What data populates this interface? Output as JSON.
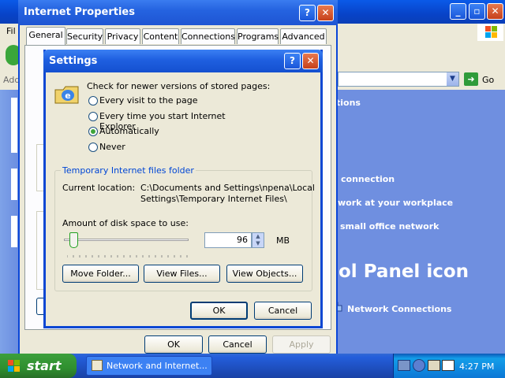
{
  "background_window": {
    "menu_partial": "Fil",
    "address_label_partial": "Add",
    "go_label": "Go",
    "tasks": [
      {
        "label": "tions"
      },
      {
        "label": "connection"
      },
      {
        "label": "work at your workplace"
      },
      {
        "label": "small office network"
      }
    ],
    "big_title": "ol Panel icon",
    "network_connections": "Network Connections"
  },
  "internet_properties": {
    "title": "Internet Properties",
    "tabs": [
      "General",
      "Security",
      "Privacy",
      "Content",
      "Connections",
      "Programs",
      "Advanced"
    ],
    "active_tab": "General",
    "buttons": {
      "ok": "OK",
      "cancel": "Cancel",
      "apply": "Apply"
    }
  },
  "settings": {
    "title": "Settings",
    "check_label": "Check for newer versions of stored pages:",
    "radios": [
      {
        "label": "Every visit to the page",
        "checked": false
      },
      {
        "label": "Every time you start Internet Explorer",
        "checked": false
      },
      {
        "label": "Automatically",
        "checked": true
      },
      {
        "label": "Never",
        "checked": false
      }
    ],
    "group_title": "Temporary Internet files folder",
    "location_label": "Current location:",
    "location_line1": "C:\\Documents and Settings\\npena\\Local",
    "location_line2": "Settings\\Temporary Internet Files\\",
    "disk_label": "Amount of disk space to use:",
    "disk_value": "96",
    "disk_unit": "MB",
    "slider_fraction": 0.05,
    "buttons": {
      "move_folder": "Move Folder...",
      "view_files": "View Files...",
      "view_objects": "View Objects...",
      "ok": "OK",
      "cancel": "Cancel"
    }
  },
  "taskbar": {
    "start": "start",
    "task_item": "Network and Internet...",
    "clock": "4:27 PM"
  },
  "colors": {
    "xp_blue": "#0a46d8",
    "start_green": "#2f8f2f",
    "accent_blue_text": "#0046d5"
  }
}
